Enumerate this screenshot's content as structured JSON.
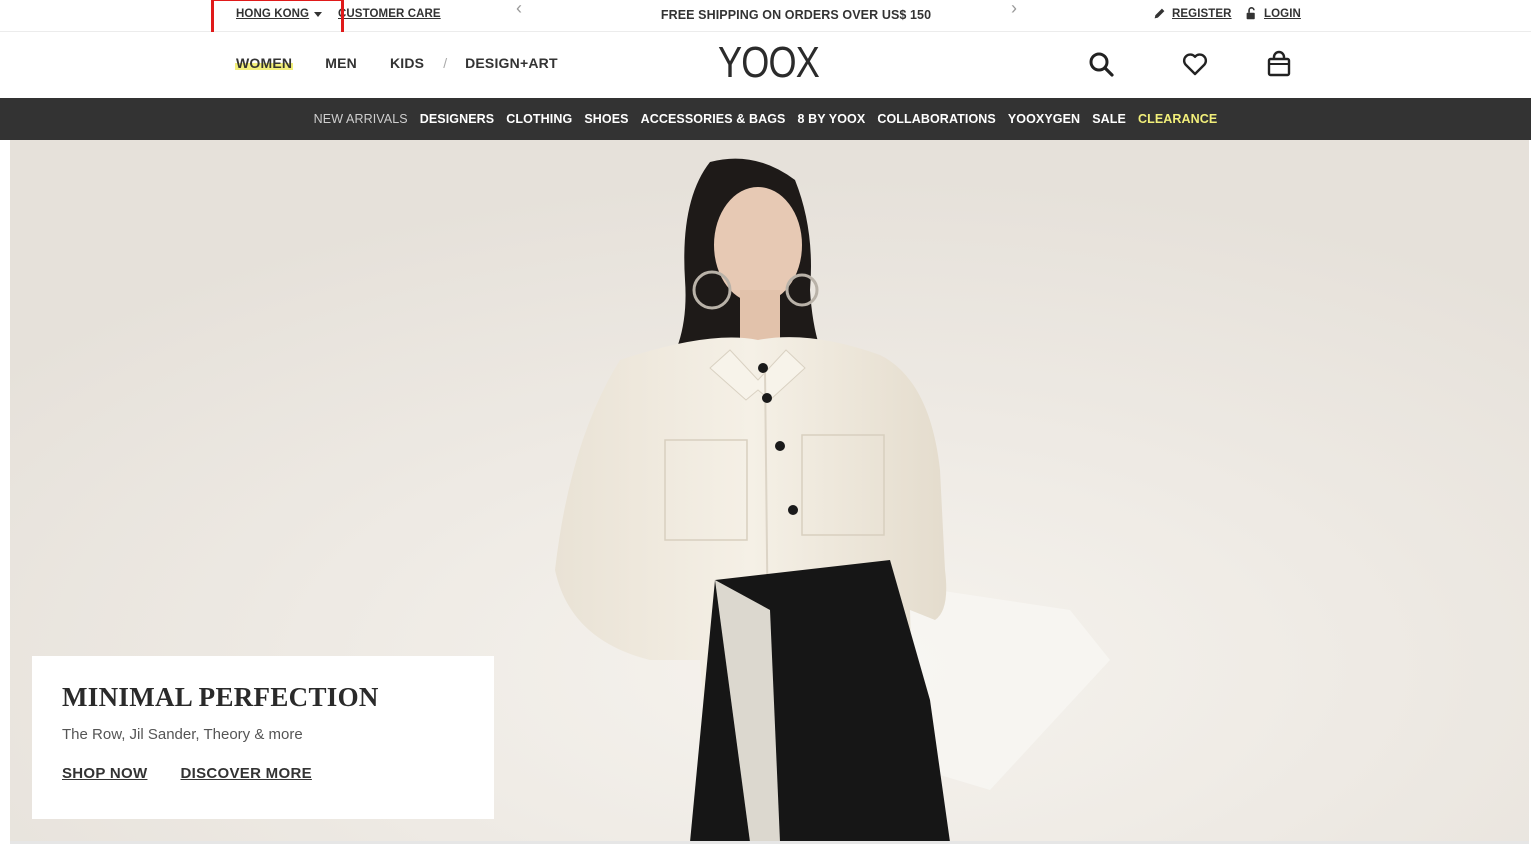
{
  "topbar": {
    "country": "HONG KONG",
    "customer_care": "CUSTOMER CARE",
    "promo": "FREE SHIPPING ON ORDERS OVER US$ 150",
    "prev_arrow": "‹",
    "next_arrow": "›",
    "register": "REGISTER",
    "login": "LOGIN"
  },
  "header": {
    "nav": [
      {
        "label": "WOMEN"
      },
      {
        "label": "MEN"
      },
      {
        "label": "KIDS"
      },
      {
        "label": "DESIGN+ART"
      }
    ],
    "separator": "/",
    "logo": "YOOX"
  },
  "categories": [
    {
      "label": "NEW ARRIVALS"
    },
    {
      "label": "DESIGNERS"
    },
    {
      "label": "CLOTHING"
    },
    {
      "label": "SHOES"
    },
    {
      "label": "ACCESSORIES & BAGS"
    },
    {
      "label": "8 BY YOOX"
    },
    {
      "label": "COLLABORATIONS"
    },
    {
      "label": "YOOXYGEN"
    },
    {
      "label": "SALE"
    },
    {
      "label": "CLEARANCE"
    }
  ],
  "hero": {
    "title": "MINIMAL PERFECTION",
    "subtitle": "The Row, Jil Sander, Theory & more",
    "shop_now": "SHOP NOW",
    "discover_more": "DISCOVER MORE"
  },
  "colors": {
    "accent_yellow": "#f2ef7a",
    "category_bar": "#333333",
    "highlight_box": "#e01a1a"
  }
}
